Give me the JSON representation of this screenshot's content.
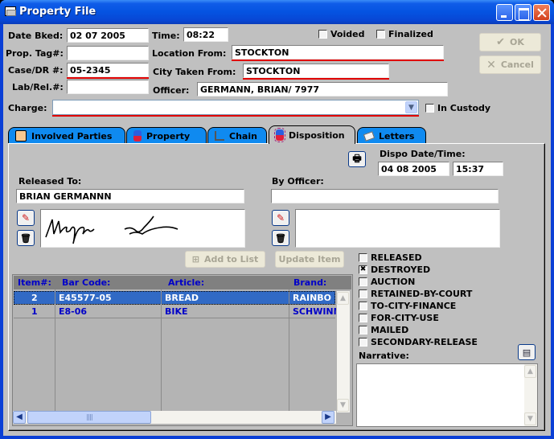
{
  "window": {
    "title": "Property File"
  },
  "header": {
    "date_booked_label": "Date Bked:",
    "date_booked_value": "02 07 2005",
    "time_label": "Time:",
    "time_value": "08:22",
    "prop_tag_label": "Prop. Tag#:",
    "prop_tag_value": "",
    "case_dr_label": "Case/DR #:",
    "case_dr_value": "05-2345",
    "lab_rel_label": "Lab/Rel.#:",
    "lab_rel_value": "",
    "location_from_label": "Location From:",
    "location_from_value": "STOCKTON",
    "city_taken_label": "City Taken From:",
    "city_taken_value": "STOCKTON",
    "officer_label": "Officer:",
    "officer_value": "GERMANN, BRIAN/ 7977",
    "voided_label": "Voided",
    "voided_checked": false,
    "finalized_label": "Finalized",
    "finalized_checked": false,
    "charge_label": "Charge:",
    "charge_value": "",
    "in_custody_label": "In Custody",
    "in_custody_checked": false,
    "ok_label": "OK",
    "cancel_label": "Cancel"
  },
  "tabs": [
    {
      "label": "Involved Parties",
      "active": false
    },
    {
      "label": "Property",
      "active": false
    },
    {
      "label": "Chain",
      "active": false
    },
    {
      "label": "Disposition",
      "active": true
    },
    {
      "label": "Letters",
      "active": false
    }
  ],
  "disposition": {
    "dispo_datetime_label": "Dispo Date/Time:",
    "dispo_date_value": "04 08 2005",
    "dispo_time_value": "15:37",
    "released_to_label": "Released To:",
    "released_to_value": "BRIAN GERMANNN",
    "by_officer_label": "By Officer:",
    "by_officer_value": "",
    "add_to_list_label": "Add to List",
    "update_item_label": "Update Item",
    "narrative_label": "Narrative:",
    "narrative_value": "",
    "options": [
      {
        "label": "RELEASED",
        "checked": false
      },
      {
        "label": "DESTROYED",
        "checked": true
      },
      {
        "label": "AUCTION",
        "checked": false
      },
      {
        "label": "RETAINED-BY-COURT",
        "checked": false
      },
      {
        "label": "TO-CITY-FINANCE",
        "checked": false
      },
      {
        "label": "FOR-CITY-USE",
        "checked": false
      },
      {
        "label": "MAILED",
        "checked": false
      },
      {
        "label": "SECONDARY-RELEASE",
        "checked": false
      }
    ]
  },
  "grid": {
    "columns": [
      "Item#:",
      "Bar Code:",
      "Article:",
      "Brand:"
    ],
    "rows": [
      {
        "item": "2",
        "bar_code": "E45577-05",
        "article": "BREAD",
        "brand": "RAINBO",
        "selected": true
      },
      {
        "item": "1",
        "bar_code": "E8-06",
        "article": "BIKE",
        "brand": "SCHWINN",
        "selected": false
      }
    ]
  }
}
